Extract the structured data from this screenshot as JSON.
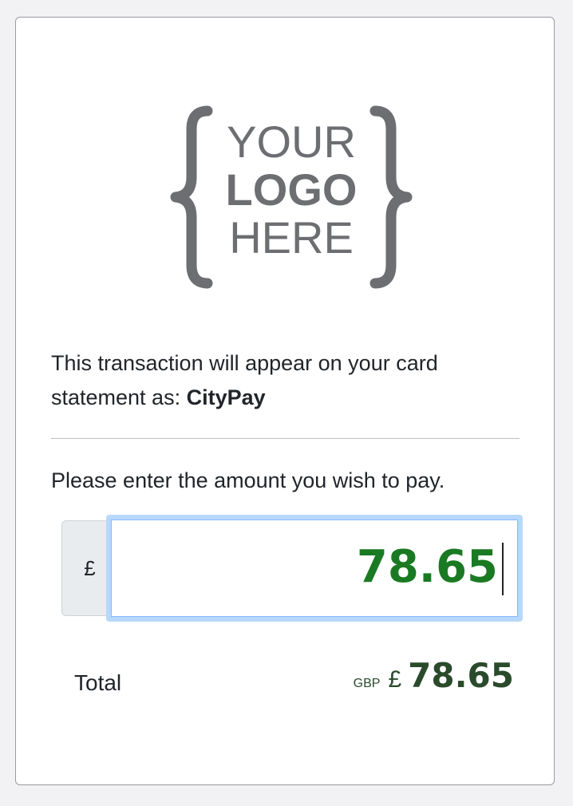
{
  "logo": {
    "line1": "YOUR",
    "line2": "LOGO",
    "line3": "HERE"
  },
  "descriptor": {
    "text": "This transaction will appear on your card statement as: ",
    "merchant": "CityPay"
  },
  "prompt": "Please enter the amount you wish to pay.",
  "amount_field": {
    "currency_symbol": "£",
    "value": "78.65"
  },
  "total": {
    "label": "Total",
    "currency_code": "GBP",
    "currency_symbol": "£",
    "amount": "78.65"
  },
  "colors": {
    "amount_green": "#1a7a23",
    "total_green": "#2a4a2c",
    "focus_ring": "#b8d8fb",
    "logo_gray": "#6d6e71"
  }
}
